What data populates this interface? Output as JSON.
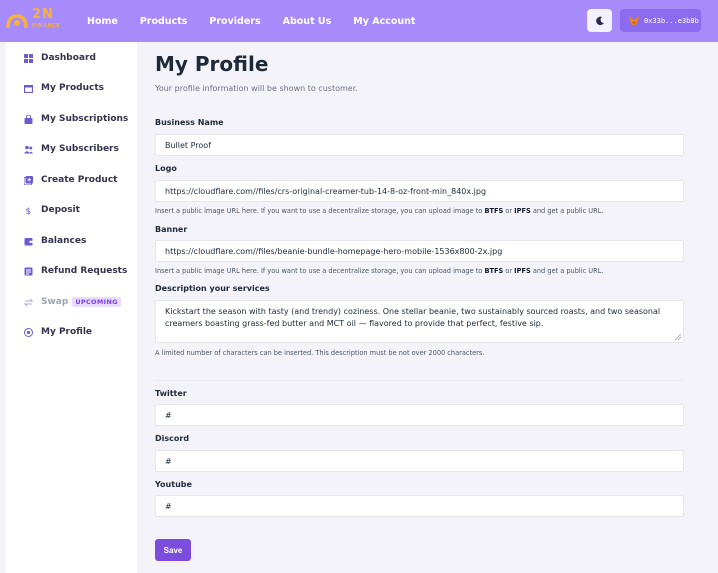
{
  "brand": {
    "logo_text": "2N",
    "logo_sub": "FINANCE"
  },
  "nav": {
    "items": [
      "Home",
      "Products",
      "Providers",
      "About Us",
      "My Account"
    ]
  },
  "wallet": {
    "address": "0x33b...e3b8b"
  },
  "sidebar": {
    "items": [
      {
        "label": "Dashboard",
        "icon": "dashboard-icon"
      },
      {
        "label": "My Products",
        "icon": "box-icon"
      },
      {
        "label": "My Subscriptions",
        "icon": "bag-icon"
      },
      {
        "label": "My Subscribers",
        "icon": "users-icon"
      },
      {
        "label": "Create Product",
        "icon": "plus-square-icon"
      },
      {
        "label": "Deposit",
        "icon": "dollar-icon"
      },
      {
        "label": "Balances",
        "icon": "wallet-icon"
      },
      {
        "label": "Refund Requests",
        "icon": "refund-icon"
      },
      {
        "label": "Swap",
        "icon": "swap-icon",
        "badge": "UPCOMING"
      },
      {
        "label": "My Profile",
        "icon": "user-circle-icon"
      }
    ]
  },
  "page": {
    "title": "My Profile",
    "subtitle": "Your profile information will be shown to customer."
  },
  "form": {
    "business_name": {
      "label": "Business Name",
      "value": "Bullet Proof"
    },
    "logo": {
      "label": "Logo",
      "value": "https://cloudflare.com//files/crs-original-creamer-tub-14-8-oz-front-min_840x.jpg"
    },
    "banner": {
      "label": "Banner",
      "value": "https://cloudflare.com//files/beanie-bundle-homepage-hero-mobile-1536x800-2x.jpg"
    },
    "help": {
      "prefix": "Insert a public image URL here. If you want to use a decentralize storage, you can upload image to ",
      "btfs": "BTFS",
      "or": " or ",
      "ipfs": "IPFS",
      "suffix": " and get a public URL."
    },
    "description": {
      "label": "Description your services",
      "value": "Kickstart the season with tasty (and trendy) coziness. One stellar beanie, two sustainably sourced roasts, and two seasonal creamers boasting grass-fed butter and MCT oil — flavored to provide that perfect, festive sip.",
      "help": "A limited number of characters can be inserted. This description must be not over 2000 characters."
    },
    "twitter": {
      "label": "Twitter",
      "value": "#"
    },
    "discord": {
      "label": "Discord",
      "value": "#"
    },
    "youtube": {
      "label": "Youtube",
      "value": "#"
    },
    "save_label": "Save"
  },
  "colors": {
    "header": "#a78bfa",
    "accent": "#7c4ddd",
    "logo": "#f6b23a"
  }
}
